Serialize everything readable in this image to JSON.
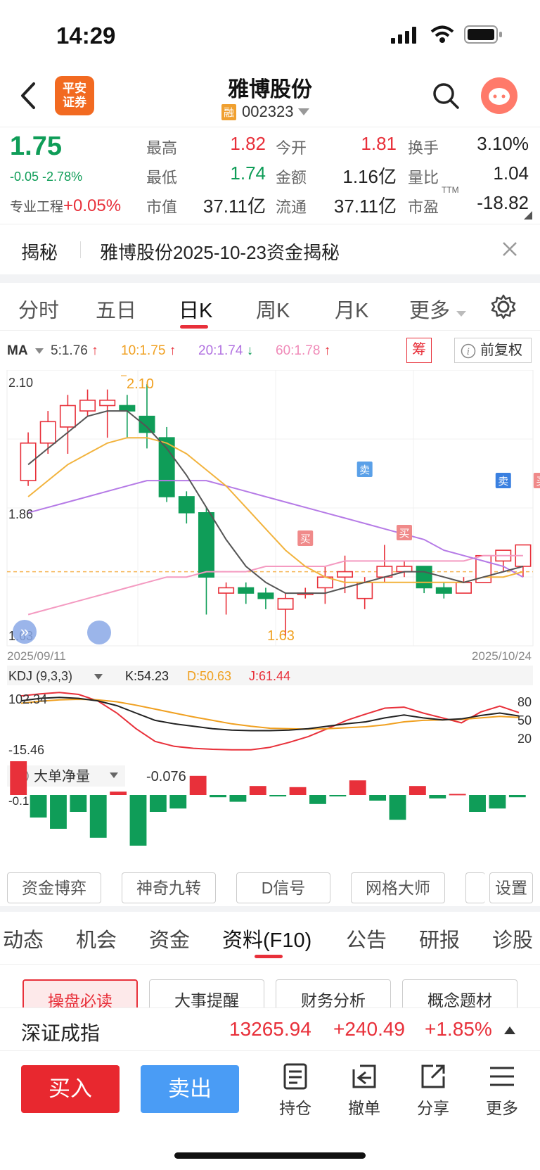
{
  "status_bar": {
    "time": "14:29"
  },
  "header": {
    "broker_logo_text": "平安\n证券",
    "stock_name": "雅博股份",
    "margin_tag": "融",
    "stock_code": "002323"
  },
  "quote": {
    "price": "1.75",
    "change": "-0.05",
    "change_pct": "-2.78%",
    "pro_label": "专业工程",
    "pro_value": "+0.05%",
    "fields": [
      {
        "label": "最高",
        "value": "1.82",
        "color": "#e8303a"
      },
      {
        "label": "今开",
        "value": "1.81",
        "color": "#e8303a"
      },
      {
        "label": "换手",
        "value": "3.10%",
        "color": "#222222"
      },
      {
        "label": "最低",
        "value": "1.74",
        "color": "#0f9d58"
      },
      {
        "label": "金额",
        "value": "1.16亿",
        "color": "#222222"
      },
      {
        "label": "量比",
        "value": "1.04",
        "color": "#222222"
      },
      {
        "label": "市值",
        "value": "37.11亿",
        "color": "#222222"
      },
      {
        "label": "流通",
        "value": "37.11亿",
        "color": "#222222"
      },
      {
        "label": "市盈",
        "value": "-18.82",
        "color": "#222222"
      }
    ],
    "ttm": "TTM"
  },
  "reveal": {
    "tag": "揭秘",
    "text": "雅博股份2025-10-23资金揭秘"
  },
  "period_tabs": [
    "分时",
    "五日",
    "日K",
    "周K",
    "月K",
    "更多"
  ],
  "active_period": "日K",
  "ma": {
    "label": "MA",
    "items": [
      {
        "text": "5:1.76",
        "color": "#444444",
        "arrow": "↑",
        "arrow_color": "#e8303a"
      },
      {
        "text": "10:1.75",
        "color": "#f0a020",
        "arrow": "↑",
        "arrow_color": "#e8303a"
      },
      {
        "text": "20:1.74",
        "color": "#b070e0",
        "arrow": "↓",
        "arrow_color": "#0f9d58"
      },
      {
        "text": "60:1.78",
        "color": "#f08ab8",
        "arrow": "↑",
        "arrow_color": "#e8303a"
      }
    ],
    "chip_label": "筹",
    "adjust_label": "前复权"
  },
  "kchart": {
    "y_top_label": "2.10",
    "y_mid_label": "1.86",
    "y_bot_label": "1.63",
    "high_annot": "2.10",
    "low_annot": "1.63",
    "date_start": "2025/09/11",
    "date_end": "2025/10/24",
    "signals": {
      "buy": "买",
      "sell": "卖"
    }
  },
  "chart_data": {
    "type": "candlestick",
    "ylim": [
      1.63,
      2.1
    ],
    "candles": [
      {
        "o": 1.92,
        "c": 1.99,
        "h": 2.01,
        "l": 1.91
      },
      {
        "o": 1.99,
        "c": 2.03,
        "h": 2.05,
        "l": 1.97
      },
      {
        "o": 2.02,
        "c": 2.06,
        "h": 2.08,
        "l": 1.97
      },
      {
        "o": 2.05,
        "c": 2.07,
        "h": 2.09,
        "l": 2.04
      },
      {
        "o": 2.06,
        "c": 2.07,
        "h": 2.09,
        "l": 2.0
      },
      {
        "o": 2.06,
        "c": 2.05,
        "h": 2.08,
        "l": 2.0
      },
      {
        "o": 2.04,
        "c": 2.01,
        "h": 2.1,
        "l": 1.98
      },
      {
        "o": 2.0,
        "c": 1.89,
        "h": 2.02,
        "l": 1.88
      },
      {
        "o": 1.89,
        "c": 1.86,
        "h": 1.9,
        "l": 1.84
      },
      {
        "o": 1.86,
        "c": 1.74,
        "h": 1.87,
        "l": 1.67
      },
      {
        "o": 1.71,
        "c": 1.72,
        "h": 1.73,
        "l": 1.67
      },
      {
        "o": 1.72,
        "c": 1.71,
        "h": 1.73,
        "l": 1.69
      },
      {
        "o": 1.71,
        "c": 1.7,
        "h": 1.72,
        "l": 1.68
      },
      {
        "o": 1.68,
        "c": 1.7,
        "h": 1.71,
        "l": 1.63
      },
      {
        "o": 1.71,
        "c": 1.71,
        "h": 1.72,
        "l": 1.7
      },
      {
        "o": 1.72,
        "c": 1.74,
        "h": 1.76,
        "l": 1.69
      },
      {
        "o": 1.74,
        "c": 1.75,
        "h": 1.78,
        "l": 1.71
      },
      {
        "o": 1.7,
        "c": 1.73,
        "h": 1.74,
        "l": 1.68
      },
      {
        "o": 1.74,
        "c": 1.76,
        "h": 1.8,
        "l": 1.73
      },
      {
        "o": 1.75,
        "c": 1.76,
        "h": 1.77,
        "l": 1.74
      },
      {
        "o": 1.76,
        "c": 1.72,
        "h": 1.76,
        "l": 1.71
      },
      {
        "o": 1.72,
        "c": 1.71,
        "h": 1.73,
        "l": 1.7
      },
      {
        "o": 1.71,
        "c": 1.73,
        "h": 1.74,
        "l": 1.71
      },
      {
        "o": 1.73,
        "c": 1.78,
        "h": 1.78,
        "l": 1.73
      },
      {
        "o": 1.77,
        "c": 1.79,
        "h": 1.79,
        "l": 1.75
      },
      {
        "o": 1.76,
        "c": 1.8,
        "h": 1.8,
        "l": 1.74
      }
    ],
    "ma5": [
      1.95,
      1.98,
      2.01,
      2.04,
      2.05,
      2.05,
      2.02,
      1.98,
      1.93,
      1.87,
      1.81,
      1.76,
      1.73,
      1.71,
      1.71,
      1.71,
      1.72,
      1.73,
      1.74,
      1.75,
      1.75,
      1.74,
      1.73,
      1.74,
      1.75,
      1.76
    ],
    "ma10": [
      1.89,
      1.92,
      1.95,
      1.97,
      1.99,
      2.0,
      2.0,
      1.99,
      1.97,
      1.94,
      1.91,
      1.87,
      1.83,
      1.79,
      1.76,
      1.74,
      1.73,
      1.73,
      1.73,
      1.73,
      1.73,
      1.73,
      1.73,
      1.74,
      1.74,
      1.75
    ],
    "ma20": [
      1.86,
      1.87,
      1.88,
      1.89,
      1.9,
      1.91,
      1.92,
      1.92,
      1.92,
      1.92,
      1.91,
      1.9,
      1.89,
      1.88,
      1.87,
      1.86,
      1.85,
      1.84,
      1.83,
      1.82,
      1.81,
      1.79,
      1.78,
      1.77,
      1.76,
      1.74
    ],
    "ma60": [
      1.67,
      1.68,
      1.69,
      1.7,
      1.71,
      1.72,
      1.73,
      1.74,
      1.74,
      1.75,
      1.75,
      1.75,
      1.76,
      1.76,
      1.76,
      1.76,
      1.77,
      1.77,
      1.77,
      1.77,
      1.77,
      1.77,
      1.77,
      1.78,
      1.78,
      1.78
    ],
    "kdj": {
      "label": "KDJ (9,3,3)",
      "k_label": "K:54.23",
      "d_label": "D:50.63",
      "j_label": "J:61.44",
      "ylim": [
        -15.46,
        102.34
      ],
      "y_top": "102.34",
      "y_bot": "-15.46",
      "levels": [
        "80",
        "50",
        "20"
      ],
      "k": [
        85,
        90,
        92,
        90,
        85,
        75,
        60,
        45,
        38,
        33,
        28,
        25,
        24,
        24,
        25,
        28,
        33,
        38,
        42,
        50,
        56,
        50,
        46,
        48,
        55,
        60,
        54
      ],
      "d": [
        80,
        84,
        87,
        88,
        87,
        83,
        76,
        68,
        60,
        52,
        45,
        38,
        33,
        29,
        28,
        27,
        28,
        30,
        32,
        36,
        42,
        45,
        46,
        47,
        50,
        53,
        51
      ],
      "j": [
        95,
        99,
        102,
        98,
        85,
        60,
        28,
        2,
        -8,
        -12,
        -14,
        -15,
        -15,
        -10,
        0,
        12,
        28,
        45,
        58,
        70,
        72,
        60,
        50,
        40,
        62,
        74,
        61
      ]
    },
    "bigorder": {
      "label": "大单净量",
      "value": "-0.076",
      "y_label": "-0.1",
      "bars": [
        0.3,
        -0.2,
        -0.3,
        -0.15,
        -0.38,
        0.03,
        -0.45,
        -0.15,
        -0.12,
        0.17,
        -0.02,
        -0.06,
        0.08,
        -0.01,
        0.07,
        -0.08,
        -0.01,
        0.13,
        -0.05,
        -0.22,
        0.08,
        -0.03,
        0.01,
        -0.15,
        -0.12,
        -0.02
      ]
    }
  },
  "tool_pills": [
    "资金博弈",
    "神奇九转",
    "D信号",
    "网格大师",
    "设置"
  ],
  "bottom_tabs": [
    "动态",
    "机会",
    "资金",
    "资料(F10)",
    "公告",
    "研报",
    "诊股"
  ],
  "active_bottom_tab": "资料(F10)",
  "sub_pills": [
    "操盘必读",
    "大事提醒",
    "财务分析",
    "概念题材"
  ],
  "index_bar": {
    "name": "深证成指",
    "value": "13265.94",
    "change": "+240.49",
    "pct": "+1.85%"
  },
  "actions": {
    "buy": "买入",
    "sell": "卖出",
    "tools": [
      "持仓",
      "撤单",
      "分享",
      "更多"
    ]
  }
}
